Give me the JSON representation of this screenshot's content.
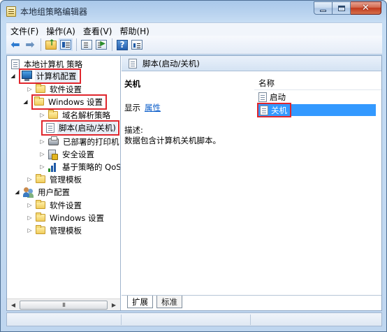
{
  "window": {
    "title": "本地组策略编辑器",
    "controls": {
      "minimize": "minimize-icon",
      "maximize": "maximize-icon",
      "close": "close-icon"
    }
  },
  "menu": {
    "items": [
      "文件(F)",
      "操作(A)",
      "查看(V)",
      "帮助(H)"
    ]
  },
  "toolbar": {
    "icons": [
      "back-arrow-icon",
      "forward-arrow-icon",
      "folder-up-icon",
      "show-tree-icon",
      "export-list-icon",
      "run-icon",
      "help-icon",
      "properties-view-icon"
    ]
  },
  "tree": {
    "root": "本地计算机 策略",
    "computer_config": "计算机配置",
    "software_settings": "软件设置",
    "windows_settings": "Windows 设置",
    "dns_policy": "域名解析策略",
    "scripts": "脚本(启动/关机)",
    "deployed_printers": "已部署的打印机",
    "security_settings": "安全设置",
    "qos": "基于策略的 QoS",
    "admin_templates": "管理模板",
    "user_config": "用户配置",
    "user_software_settings": "软件设置",
    "user_windows_settings": "Windows 设置",
    "user_admin_templates": "管理模板"
  },
  "scrollbar": {
    "thumb_grip": "III"
  },
  "right_pane": {
    "header": "脚本(启动/关机)",
    "extended": {
      "title": "关机",
      "show_label": "显示",
      "properties_link": "属性",
      "description_label": "描述:",
      "description_text": "数据包含计算机关机脚本。"
    },
    "list": {
      "column_name": "名称",
      "items": [
        "启动",
        "关机"
      ],
      "selected_index": 1
    },
    "tabs": [
      "扩展",
      "标准"
    ]
  },
  "colors": {
    "highlight_box": "#e0262d",
    "selection_bg": "#3399ff",
    "link": "#0a5cc9"
  }
}
